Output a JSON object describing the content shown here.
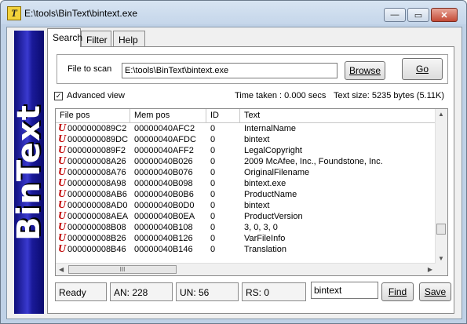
{
  "window": {
    "title": "E:\\tools\\BinText\\bintext.exe",
    "app_icon": "T",
    "min_glyph": "—",
    "max_glyph": "▭",
    "close_glyph": "✕"
  },
  "banner": {
    "text": "BinText"
  },
  "tabs": [
    {
      "label": "Search"
    },
    {
      "label": "Filter"
    },
    {
      "label": "Help"
    }
  ],
  "file": {
    "label": "File to scan",
    "value": "E:\\tools\\BinText\\bintext.exe"
  },
  "buttons": {
    "browse": "Browse",
    "go": "Go",
    "find": "Find",
    "save": "Save"
  },
  "options": {
    "advanced_view_label": "Advanced view",
    "advanced_view_checked": true,
    "check_glyph": "✓"
  },
  "stats": {
    "time_taken": "Time taken : 0.000 secs",
    "text_size": "Text size: 5235 bytes (5.11K)"
  },
  "table": {
    "columns": [
      "File pos",
      "Mem pos",
      "ID",
      "Text"
    ],
    "row_icon": "U",
    "rows": [
      {
        "file_pos": "0000000089C2",
        "mem_pos": "00000040AFC2",
        "id": "0",
        "text": "InternalName"
      },
      {
        "file_pos": "0000000089DC",
        "mem_pos": "00000040AFDC",
        "id": "0",
        "text": "bintext"
      },
      {
        "file_pos": "0000000089F2",
        "mem_pos": "00000040AFF2",
        "id": "0",
        "text": "LegalCopyright"
      },
      {
        "file_pos": "000000008A26",
        "mem_pos": "00000040B026",
        "id": "0",
        "text": " 2009 McAfee, Inc., Foundstone, Inc."
      },
      {
        "file_pos": "000000008A76",
        "mem_pos": "00000040B076",
        "id": "0",
        "text": "OriginalFilename"
      },
      {
        "file_pos": "000000008A98",
        "mem_pos": "00000040B098",
        "id": "0",
        "text": "bintext.exe"
      },
      {
        "file_pos": "000000008AB6",
        "mem_pos": "00000040B0B6",
        "id": "0",
        "text": "ProductName"
      },
      {
        "file_pos": "000000008AD0",
        "mem_pos": "00000040B0D0",
        "id": "0",
        "text": "  bintext"
      },
      {
        "file_pos": "000000008AEA",
        "mem_pos": "00000040B0EA",
        "id": "0",
        "text": "ProductVersion"
      },
      {
        "file_pos": "000000008B08",
        "mem_pos": "00000040B108",
        "id": "0",
        "text": "3, 0, 3, 0"
      },
      {
        "file_pos": "000000008B26",
        "mem_pos": "00000040B126",
        "id": "0",
        "text": "VarFileInfo"
      },
      {
        "file_pos": "000000008B46",
        "mem_pos": "00000040B146",
        "id": "0",
        "text": "Translation"
      }
    ]
  },
  "scrollbar": {
    "thumb_grip": "III",
    "up": "▲",
    "down": "▼",
    "left": "◀",
    "right": "▶"
  },
  "status": {
    "ready": "Ready",
    "an": "AN: 228",
    "un": "UN: 56",
    "rs": "RS: 0"
  },
  "search": {
    "value": "bintext"
  }
}
